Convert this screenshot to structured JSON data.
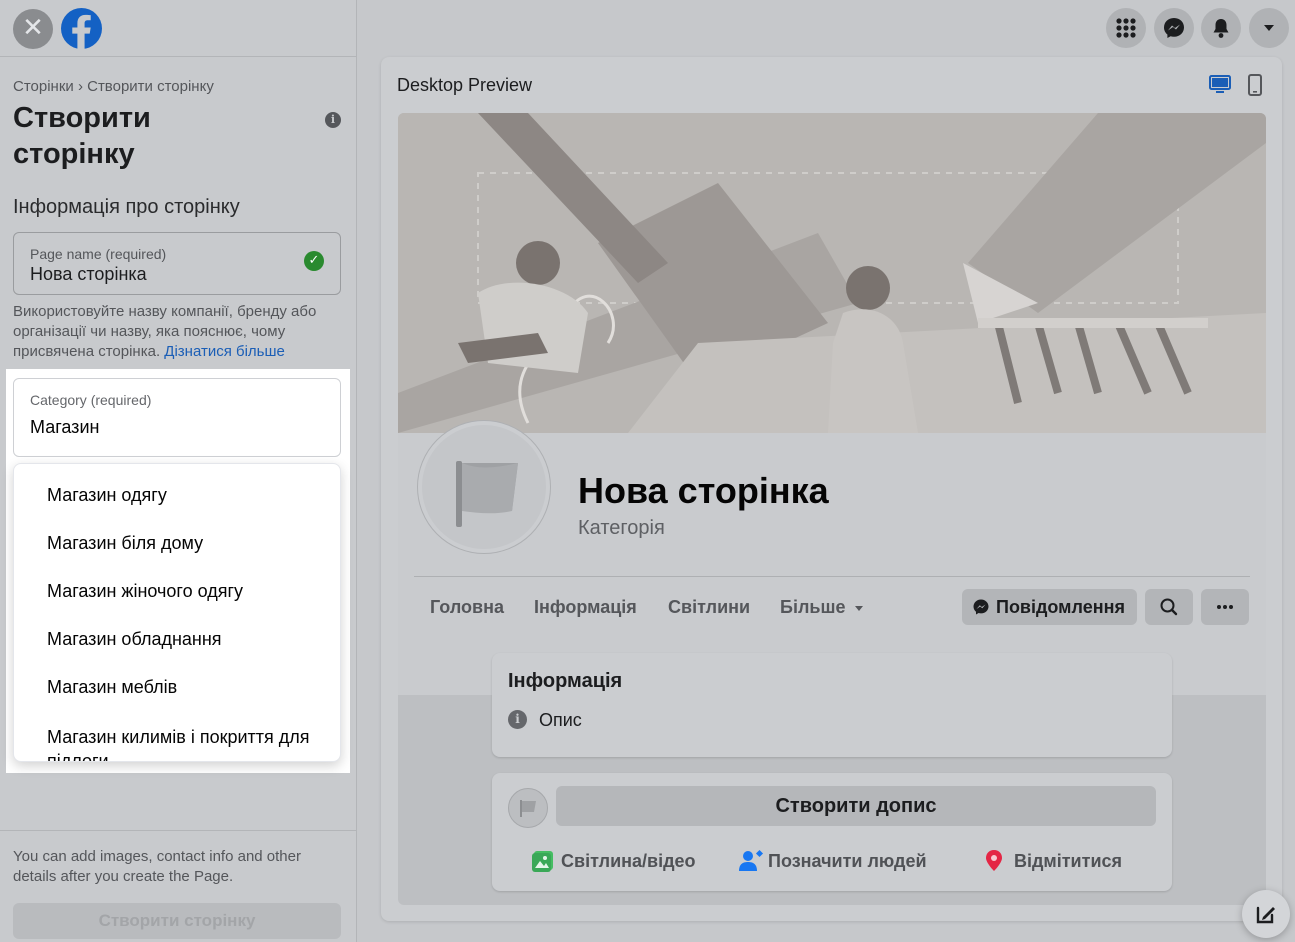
{
  "sidebar": {
    "breadcrumb": "Сторінки › Створити сторінку",
    "title": "Створити сторінку",
    "section_heading": "Інформація про сторінку",
    "page_name": {
      "label": "Page name (required)",
      "value": "Нова сторінка"
    },
    "help_text": "Використовуйте назву компанії, бренду або організації чи назву, яка пояснює, чому присвячена сторінка.",
    "help_link": "Дізнатися більше",
    "category": {
      "label": "Category (required)",
      "value": "Магазин"
    },
    "dropdown_options": [
      "Магазин одягу",
      "Магазин біля дому",
      "Магазин жіночого одягу",
      "Магазин обладнання",
      "Магазин меблів",
      "Магазин килимів і покриття для підлоги"
    ],
    "footer_text": "You can add images, contact info and other details after you create the Page.",
    "create_button": "Створити сторінку"
  },
  "preview": {
    "title": "Desktop Preview",
    "page_name": "Нова сторінка",
    "category": "Категорія",
    "tabs": [
      "Головна",
      "Інформація",
      "Світлини",
      "Більше"
    ],
    "message_button": "Повідомлення",
    "info_card": {
      "title": "Інформація",
      "description": "Опис"
    },
    "post": {
      "button": "Створити допис",
      "actions": [
        "Світлина/відео",
        "Позначити людей",
        "Відмітитися"
      ]
    }
  },
  "colors": {
    "accent_blue": "#1b5eb6",
    "check_green": "#2a8a2f",
    "photo_green": "#45bd62",
    "tag_blue": "#1877f2",
    "checkin_red": "#e42645"
  },
  "icons": [
    "close-icon",
    "facebook-logo-icon",
    "info-icon",
    "check-icon",
    "menu-grid-icon",
    "messenger-icon",
    "bell-icon",
    "caret-down-icon",
    "desktop-icon",
    "mobile-icon",
    "flag-icon",
    "search-icon",
    "more-icon",
    "photo-icon",
    "tag-people-icon",
    "location-pin-icon",
    "compose-icon"
  ]
}
